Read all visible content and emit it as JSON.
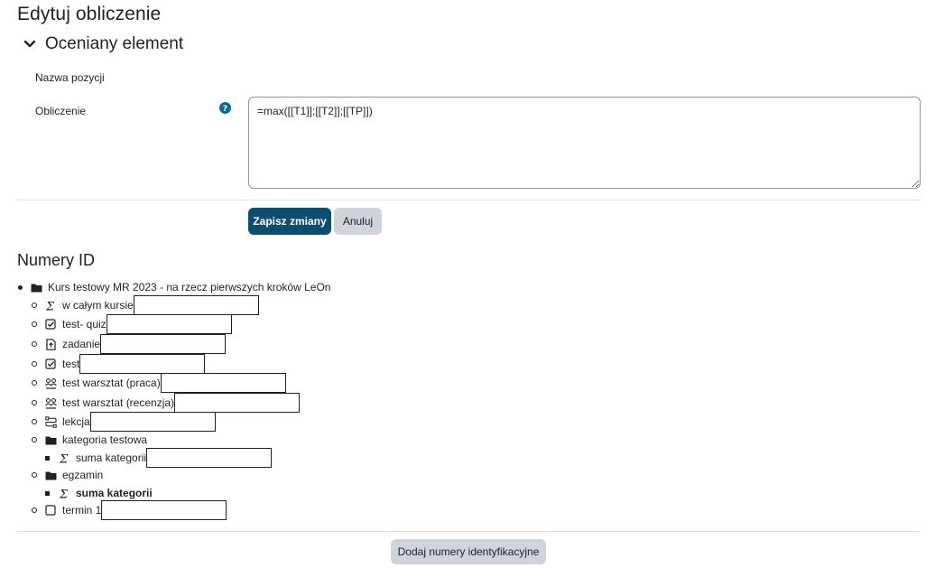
{
  "page": {
    "title": "Edytuj obliczenie"
  },
  "section": {
    "title": "Oceniany element"
  },
  "form": {
    "name_label": "Nazwa pozycji",
    "calculation_label": "Obliczenie",
    "calculation_value": "=max([[T1]];[[T2]];[[TP]])"
  },
  "buttons": {
    "save": "Zapisz zmiany",
    "cancel": "Anuluj",
    "add_ids": "Dodaj numery identyfikacyjne"
  },
  "id_section": {
    "title": "Numery ID",
    "course": {
      "label": "Kurs testowy MR 2023 - na rzecz pierwszych kroków LeOn",
      "icon": "folder-icon"
    },
    "items": [
      {
        "label": "w całym kursie",
        "icon": "sigma-icon",
        "value": ""
      },
      {
        "label": "test- quiz",
        "icon": "checkbox-checked-icon",
        "value": ""
      },
      {
        "label": "zadanie",
        "icon": "assignment-icon",
        "value": ""
      },
      {
        "label": "test",
        "icon": "checkbox-checked-icon",
        "value": ""
      },
      {
        "label": "test warsztat (praca)",
        "icon": "workshop-icon",
        "value": ""
      },
      {
        "label": "test warsztat (recenzja)",
        "icon": "workshop-icon",
        "value": ""
      },
      {
        "label": "lekcja",
        "icon": "lesson-icon",
        "value": ""
      },
      {
        "label": "kategoria testowa",
        "icon": "folder-icon"
      },
      {
        "label": "suma kategorii",
        "icon": "sigma-icon",
        "value": ""
      },
      {
        "label": "egzamin",
        "icon": "folder-icon"
      },
      {
        "label": "suma kategorii",
        "icon": "sigma-icon"
      },
      {
        "label": "termin 1",
        "icon": "checkbox-empty-icon",
        "value": ""
      }
    ]
  }
}
